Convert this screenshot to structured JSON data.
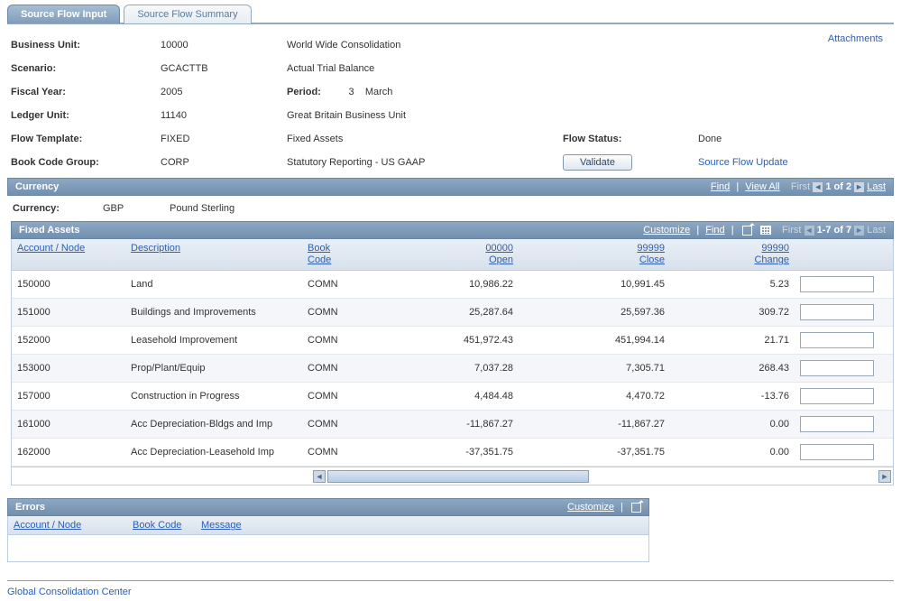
{
  "tabs": {
    "input": "Source Flow Input",
    "summary": "Source Flow Summary"
  },
  "header_links": {
    "attachments": "Attachments",
    "update": "Source Flow Update"
  },
  "info": {
    "bu_label": "Business Unit:",
    "bu_val": "10000",
    "bu_desc": "World Wide Consolidation",
    "scen_label": "Scenario:",
    "scen_val": "GCACTTB",
    "scen_desc": "Actual Trial Balance",
    "fy_label": "Fiscal Year:",
    "fy_val": "2005",
    "period_label": "Period:",
    "period_num": "3",
    "period_name": "March",
    "lu_label": "Ledger Unit:",
    "lu_val": "11140",
    "lu_desc": "Great Britain Business Unit",
    "ft_label": "Flow Template:",
    "ft_val": "FIXED",
    "ft_desc": "Fixed Assets",
    "bcg_label": "Book Code Group:",
    "bcg_val": "CORP",
    "bcg_desc": "Statutory Reporting - US GAAP",
    "status_label": "Flow Status:",
    "status_val": "Done",
    "validate_btn": "Validate"
  },
  "currency_section": {
    "title": "Currency",
    "nav": {
      "find": "Find",
      "view_all": "View All",
      "first": "First",
      "last": "Last",
      "pos": "1 of 2"
    },
    "label": "Currency:",
    "code": "GBP",
    "name": "Pound Sterling"
  },
  "fixed_assets": {
    "title": "Fixed Assets",
    "nav": {
      "customize": "Customize",
      "find": "Find",
      "first": "First",
      "last": "Last",
      "range": "1-7 of 7"
    },
    "cols": {
      "account": "Account / Node",
      "desc": "Description",
      "bc_top": "Book",
      "bc_bot": "Code",
      "open_top": "00000",
      "open_bot": "Open",
      "close_top": "99999",
      "close_bot": "Close",
      "chg_top": "99990",
      "chg_bot": "Change"
    },
    "rows": [
      {
        "acct": "150000",
        "desc": "Land",
        "bc": "COMN",
        "open": "10,986.22",
        "close": "10,991.45",
        "chg": "5.23"
      },
      {
        "acct": "151000",
        "desc": "Buildings and Improvements",
        "bc": "COMN",
        "open": "25,287.64",
        "close": "25,597.36",
        "chg": "309.72"
      },
      {
        "acct": "152000",
        "desc": "Leasehold Improvement",
        "bc": "COMN",
        "open": "451,972.43",
        "close": "451,994.14",
        "chg": "21.71"
      },
      {
        "acct": "153000",
        "desc": "Prop/Plant/Equip",
        "bc": "COMN",
        "open": "7,037.28",
        "close": "7,305.71",
        "chg": "268.43"
      },
      {
        "acct": "157000",
        "desc": "Construction   in Progress",
        "bc": "COMN",
        "open": "4,484.48",
        "close": "4,470.72",
        "chg": "-13.76"
      },
      {
        "acct": "161000",
        "desc": "Acc Depreciation-Bldgs and Imp",
        "bc": "COMN",
        "open": "-11,867.27",
        "close": "-11,867.27",
        "chg": "0.00"
      },
      {
        "acct": "162000",
        "desc": "Acc Depreciation-Leasehold Imp",
        "bc": "COMN",
        "open": "-37,351.75",
        "close": "-37,351.75",
        "chg": "0.00"
      }
    ]
  },
  "errors": {
    "title": "Errors",
    "nav": {
      "customize": "Customize"
    },
    "cols": {
      "account": "Account / Node",
      "bc": "Book Code",
      "msg": "Message"
    }
  },
  "footer": {
    "gcc": "Global Consolidation Center"
  }
}
